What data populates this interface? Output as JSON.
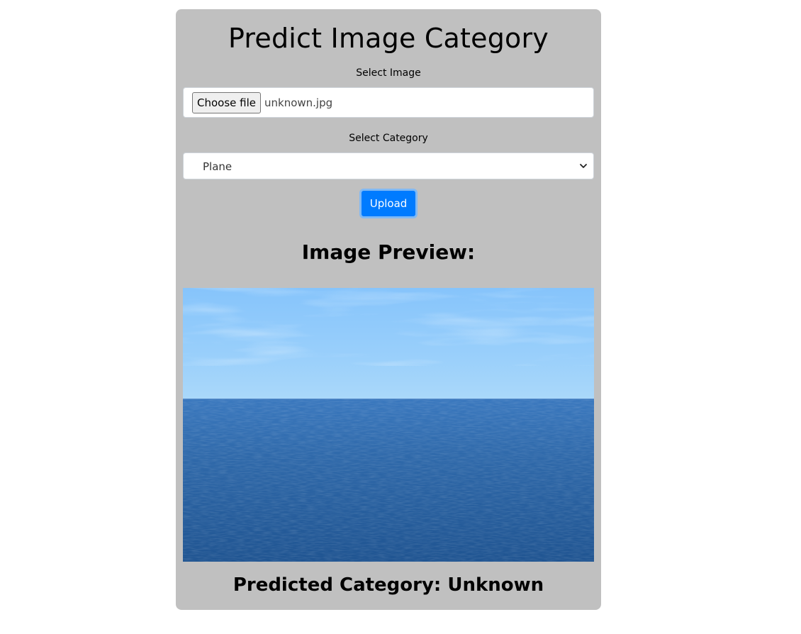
{
  "page": {
    "title": "Predict Image Category"
  },
  "form": {
    "image_label": "Select Image",
    "file_button_label": "Choose file",
    "file_name": "unknown.jpg",
    "category_label": "Select Category",
    "category_selected": "Plane",
    "upload_label": "Upload"
  },
  "preview": {
    "heading": "Image Preview:",
    "image_subject": "open sea under blue sky"
  },
  "result": {
    "predicted_text": "Predicted Category: Unknown"
  },
  "colors": {
    "card_background": "#c0c0c0",
    "upload_button": "#007bff",
    "sky": "#9fd2fb",
    "sea": "#2e67a6"
  },
  "icons": {
    "select_arrow": "chevron-down-icon"
  }
}
